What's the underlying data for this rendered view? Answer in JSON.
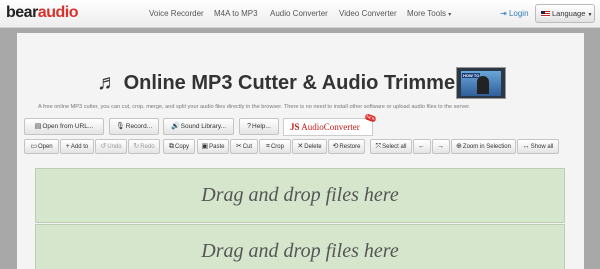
{
  "logo": {
    "part1": "bear",
    "part2": "audio"
  },
  "nav": {
    "items": [
      {
        "label": "Voice Recorder"
      },
      {
        "label": "M4A to MP3"
      },
      {
        "label": "Audio Converter"
      },
      {
        "label": "Video Converter"
      },
      {
        "label": "More Tools",
        "caret": "▾"
      }
    ],
    "login": "Login",
    "language": "Language"
  },
  "page": {
    "title": "Online MP3 Cutter & Audio Trimmer",
    "thumbnail_tag": "HOW TO",
    "description": "A free online MP3 cutter, you can cut, crop, merge, and split your audio files directly in the browser. There is no need to install other software or upload audio files to the server."
  },
  "actions": [
    {
      "label": "Open from URL...",
      "icon": "file-icon"
    },
    {
      "label": "Record...",
      "icon": "microphone-icon"
    },
    {
      "label": "Sound Library...",
      "icon": "speaker-icon"
    },
    {
      "label": "Help...",
      "icon": "question-icon"
    }
  ],
  "js_converter": {
    "js": "JS",
    "text": "AudioConverter",
    "badge": "NEW"
  },
  "toolbar": [
    {
      "label": "Open",
      "icon": "folder-icon",
      "enabled": true
    },
    {
      "label": "Add to",
      "icon": "plus-icon",
      "enabled": true
    },
    {
      "label": "Undo",
      "icon": "undo-icon",
      "enabled": false
    },
    {
      "label": "Redo",
      "icon": "redo-icon",
      "enabled": false
    },
    {
      "label": "Copy",
      "icon": "copy-icon",
      "enabled": true
    },
    {
      "label": "Paste",
      "icon": "paste-icon",
      "enabled": true
    },
    {
      "label": "Cut",
      "icon": "scissors-icon",
      "enabled": true
    },
    {
      "label": "Crop",
      "icon": "crop-icon",
      "enabled": true
    },
    {
      "label": "Delete",
      "icon": "delete-icon",
      "enabled": true
    },
    {
      "label": "Restore",
      "icon": "restore-icon",
      "enabled": true
    },
    {
      "label": "Select all",
      "icon": "select-all-icon",
      "enabled": true
    },
    {
      "label": "",
      "icon": "arrow-left-icon",
      "enabled": true
    },
    {
      "label": "",
      "icon": "arrow-right-icon",
      "enabled": true
    },
    {
      "label": "Zoom in Selection",
      "icon": "zoom-icon",
      "enabled": true
    },
    {
      "label": "Show all",
      "icon": "show-all-icon",
      "enabled": true
    }
  ],
  "dropzones": [
    {
      "text": "Drag and drop files here"
    },
    {
      "text": "Drag and drop files here"
    }
  ],
  "colors": {
    "brand_red": "#d9322e",
    "link_blue": "#337ab7",
    "dropzone_green": "#d5e6cd",
    "page_bg": "#a8a8a8"
  }
}
